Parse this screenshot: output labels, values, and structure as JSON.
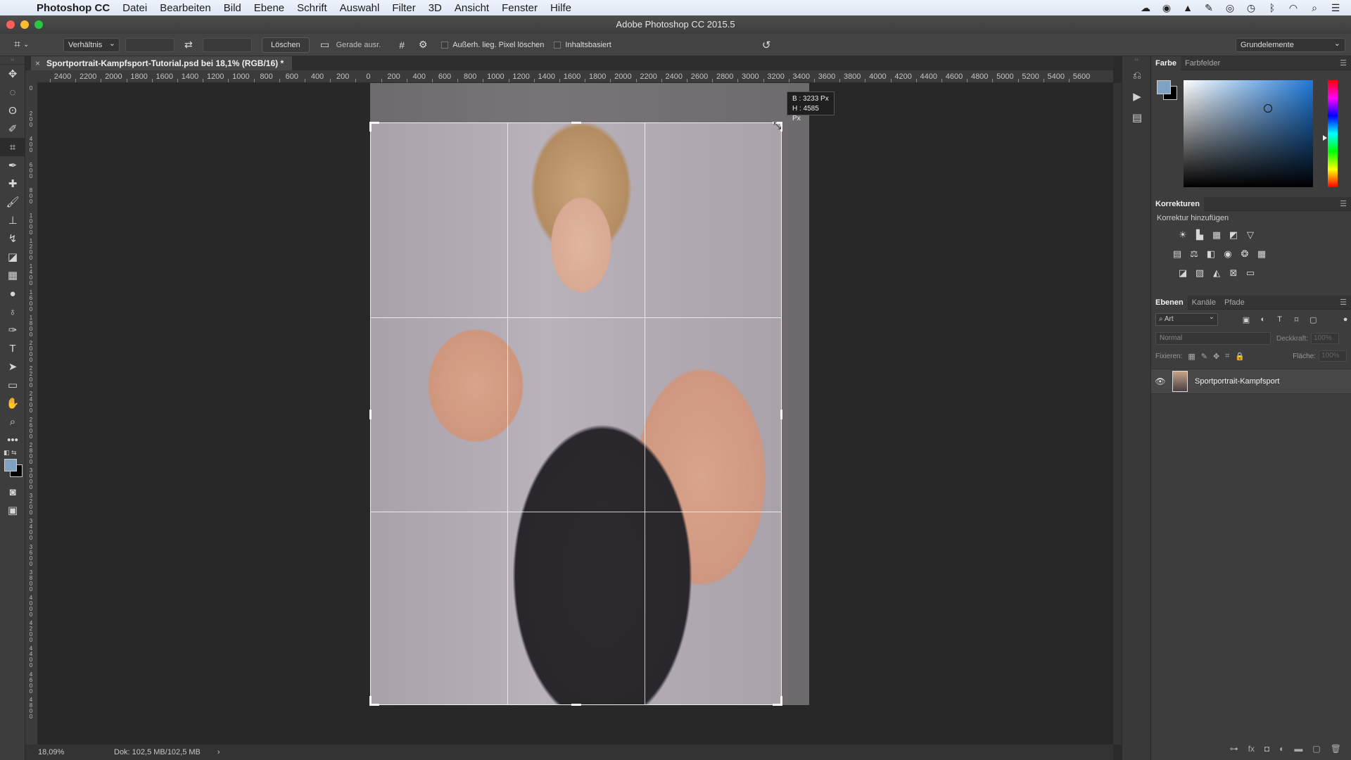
{
  "menubar": {
    "app": "Photoshop CC",
    "items": [
      "Datei",
      "Bearbeiten",
      "Bild",
      "Ebene",
      "Schrift",
      "Auswahl",
      "Filter",
      "3D",
      "Ansicht",
      "Fenster",
      "Hilfe"
    ]
  },
  "window": {
    "title": "Adobe Photoshop CC 2015.5"
  },
  "options": {
    "ratio_select": "Verhältnis",
    "clear_button": "Löschen",
    "straighten_label": "Gerade ausr.",
    "delete_pixels_label": "Außerh. lieg. Pixel löschen",
    "content_aware_label": "Inhaltsbasiert",
    "workspace": "Grundelemente"
  },
  "document": {
    "tab_title": "Sportportrait-Kampfsport-Tutorial.psd bei 18,1% (RGB/16) *",
    "close": "×"
  },
  "ruler": {
    "h_labels": [
      "2400",
      "2200",
      "2000",
      "1800",
      "1600",
      "1400",
      "1200",
      "1000",
      "800",
      "600",
      "400",
      "200",
      "0",
      "200",
      "400",
      "600",
      "800",
      "1000",
      "1200",
      "1400",
      "1600",
      "1800",
      "2000",
      "2200",
      "2400",
      "2600",
      "2800",
      "3000",
      "3200",
      "3400",
      "3600",
      "3800",
      "4000",
      "4200",
      "4400",
      "4600",
      "4800",
      "5000",
      "5200",
      "5400",
      "5600"
    ]
  },
  "crop": {
    "width_readout": "B : 3233 Px",
    "height_readout": "H : 4585 Px"
  },
  "panels": {
    "color_tabs": [
      "Farbe",
      "Farbfelder"
    ],
    "adjustments_title": "Korrekturen",
    "adjustments_subtitle": "Korrektur hinzufügen",
    "layer_tabs": [
      "Ebenen",
      "Kanäle",
      "Pfade"
    ],
    "kind_filter": "Art",
    "blend_mode": "Normal",
    "opacity_label": "Deckkraft:",
    "opacity_value": "100%",
    "lock_label": "Fixieren:",
    "fill_label": "Fläche:",
    "fill_value": "100%",
    "layer_name": "Sportportrait-Kampfsport"
  },
  "status": {
    "zoom": "18,09%",
    "doc": "Dok: 102,5 MB/102,5 MB",
    "arrow": "›"
  },
  "colors": {
    "foreground": "#7fa2c4",
    "background": "#000000",
    "accent": "#1e78d8"
  }
}
